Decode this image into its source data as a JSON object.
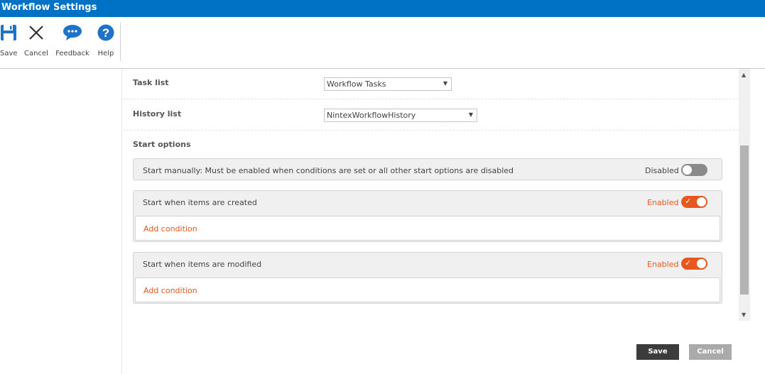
{
  "window": {
    "title": "Workflow Settings"
  },
  "ribbon": {
    "buttons": [
      {
        "label": "Save",
        "icon": "save-icon"
      },
      {
        "label": "Cancel",
        "icon": "close-icon"
      },
      {
        "label": "Feedback",
        "icon": "speech-bubble-icon"
      },
      {
        "label": "Help",
        "icon": "help-icon"
      }
    ]
  },
  "settings": {
    "task_list": {
      "label": "Task list",
      "value": "Workflow Tasks"
    },
    "history_list": {
      "label": "History list",
      "value": "NintexWorkflowHistory"
    },
    "start_options": {
      "title": "Start options",
      "options": [
        {
          "label": "Start manually: Must be enabled when conditions are set or all other start options are disabled",
          "state": "Disabled",
          "enabled": false
        },
        {
          "label": "Start when items are created",
          "state": "Enabled",
          "enabled": true,
          "condition_link": "Add condition"
        },
        {
          "label": "Start when items are modified",
          "state": "Enabled",
          "enabled": true,
          "condition_link": "Add condition"
        }
      ]
    }
  },
  "footer": {
    "save_label": "Save",
    "cancel_label": "Cancel"
  },
  "colors": {
    "titlebar": "#0072c6",
    "accent": "#e8571e",
    "save_button": "#3c3c3c",
    "cancel_button": "#aaaaaa",
    "icon_blue": "#1e73c8"
  }
}
